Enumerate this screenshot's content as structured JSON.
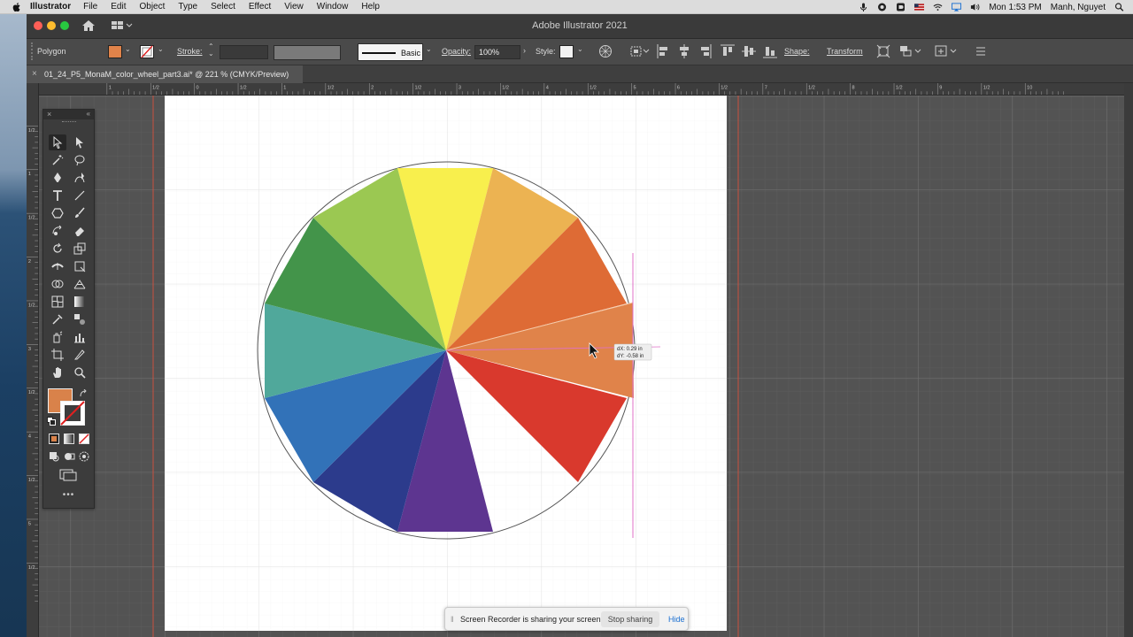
{
  "menubar": {
    "app": "Illustrator",
    "items": [
      "File",
      "Edit",
      "Object",
      "Type",
      "Select",
      "Effect",
      "View",
      "Window",
      "Help"
    ],
    "clock": "Mon 1:53 PM",
    "user": "Manh, Nguyet"
  },
  "window": {
    "title": "Adobe Illustrator 2021"
  },
  "control": {
    "object_type": "Polygon",
    "fill_color": "#e0834a",
    "stroke_label": "Stroke:",
    "brush_label": "Basic",
    "opacity_label": "Opacity:",
    "opacity_value": "100%",
    "style_label": "Style:",
    "shape_label": "Shape:",
    "transform_label": "Transform"
  },
  "document": {
    "tab_title": "01_24_P5_MonaM_color_wheel_part3.ai* @ 221 % (CMYK/Preview)",
    "close": "×"
  },
  "ruler": {
    "top_labels": [
      "1",
      "1/2",
      "0",
      "1/2",
      "1",
      "1/2",
      "2",
      "1/2",
      "3",
      "1/2",
      "4",
      "1/2",
      "5",
      "6",
      "1/2",
      "7",
      "1/2",
      "8",
      "1/2",
      "9",
      "1/2",
      "10"
    ],
    "left_labels": [
      "1/2",
      "1",
      "1/2",
      "2",
      "1/2",
      "3",
      "1/2",
      "4",
      "1/2",
      "5",
      "1/2"
    ]
  },
  "wheel": {
    "colors": [
      "#f8ef4d",
      "#ecb352",
      "#de6b35",
      "#e0834a",
      "#d9392d",
      "#5d3590",
      "#2c3b8c",
      "#3272b8",
      "#50a89b",
      "#43944a",
      "#9bc852"
    ],
    "guide_color": "#e070c8"
  },
  "tooltip": {
    "dx": "dX: 0.29 in",
    "dy": "dY: -0.58 in"
  },
  "toolbar": {
    "fill_color": "#d9824a",
    "more": "•••"
  },
  "share_banner": {
    "message": "Screen Recorder is sharing your screen.",
    "stop": "Stop sharing",
    "hide": "Hide"
  }
}
